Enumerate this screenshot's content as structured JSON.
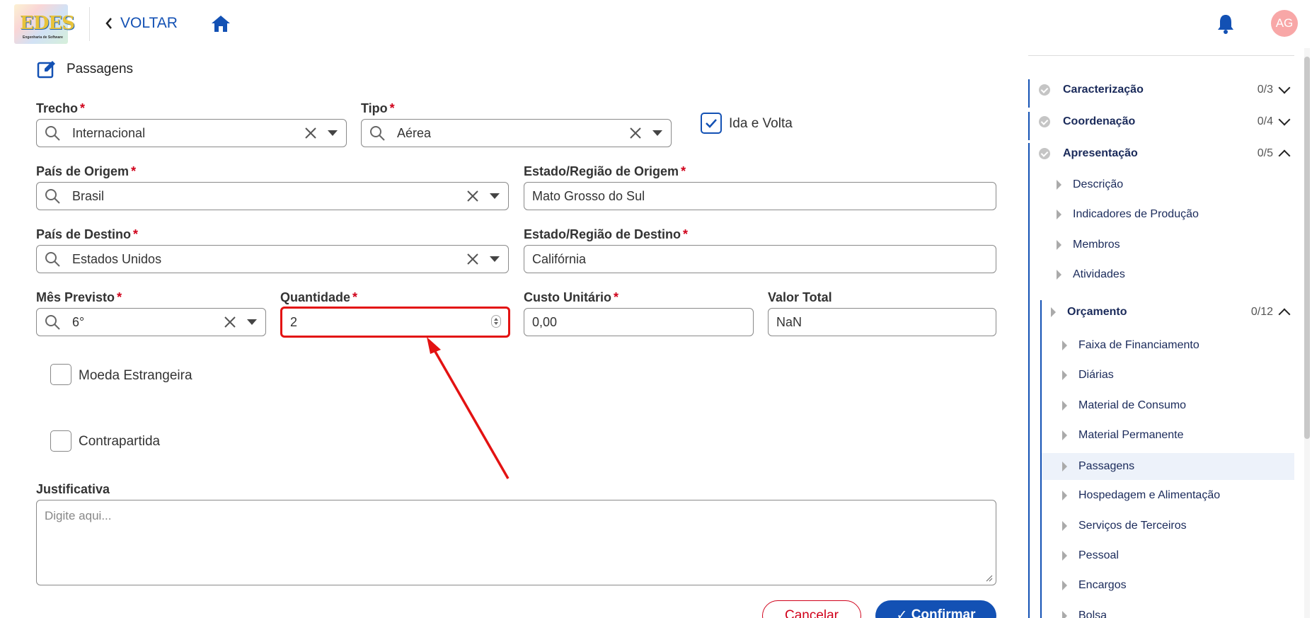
{
  "header": {
    "logo_text": "EDES",
    "logo_sub": "Engenharia de Software",
    "back_label": "VOLTAR",
    "avatar_initials": "AG"
  },
  "section": {
    "title": "Passagens"
  },
  "form": {
    "trecho": {
      "label": "Trecho",
      "value": "Internacional"
    },
    "tipo": {
      "label": "Tipo",
      "value": "Aérea"
    },
    "ida_volta": {
      "label": "Ida e Volta",
      "checked": true
    },
    "pais_origem": {
      "label": "País de Origem",
      "value": "Brasil"
    },
    "estado_origem": {
      "label": "Estado/Região de Origem",
      "value": "Mato Grosso do Sul"
    },
    "pais_destino": {
      "label": "País de Destino",
      "value": "Estados Unidos"
    },
    "estado_destino": {
      "label": "Estado/Região de Destino",
      "value": "Califórnia"
    },
    "mes": {
      "label": "Mês Previsto",
      "value": "6°"
    },
    "quantidade": {
      "label": "Quantidade",
      "value": "2"
    },
    "custo": {
      "label": "Custo Unitário",
      "value": "0,00"
    },
    "valor_total": {
      "label": "Valor Total",
      "value": "NaN"
    },
    "moeda": {
      "label": "Moeda Estrangeira",
      "checked": false
    },
    "contrapartida": {
      "label": "Contrapartida",
      "checked": false
    },
    "justificativa": {
      "label": "Justificativa",
      "placeholder": "Digite aqui..."
    },
    "required_mark": "*"
  },
  "buttons": {
    "cancel": "Cancelar",
    "confirm": "Confirmar"
  },
  "sidebar": {
    "sections": [
      {
        "name": "Caracterização",
        "count": "0/3"
      },
      {
        "name": "Coordenação",
        "count": "0/4"
      },
      {
        "name": "Apresentação",
        "count": "0/5"
      }
    ],
    "apresentacao_items": [
      "Descrição",
      "Indicadores de Produção",
      "Membros",
      "Atividades"
    ],
    "orcamento": {
      "name": "Orçamento",
      "count": "0/12"
    },
    "orcamento_items": [
      "Faixa de Financiamento",
      "Diárias",
      "Material de Consumo",
      "Material Permanente",
      "Passagens",
      "Hospedagem e Alimentação",
      "Serviços de Terceiros",
      "Pessoal",
      "Encargos",
      "Bolsa"
    ],
    "active_item": "Passagens"
  },
  "colors": {
    "primary": "#1351b4",
    "danger": "#d0021b",
    "highlight": "#e31212"
  }
}
